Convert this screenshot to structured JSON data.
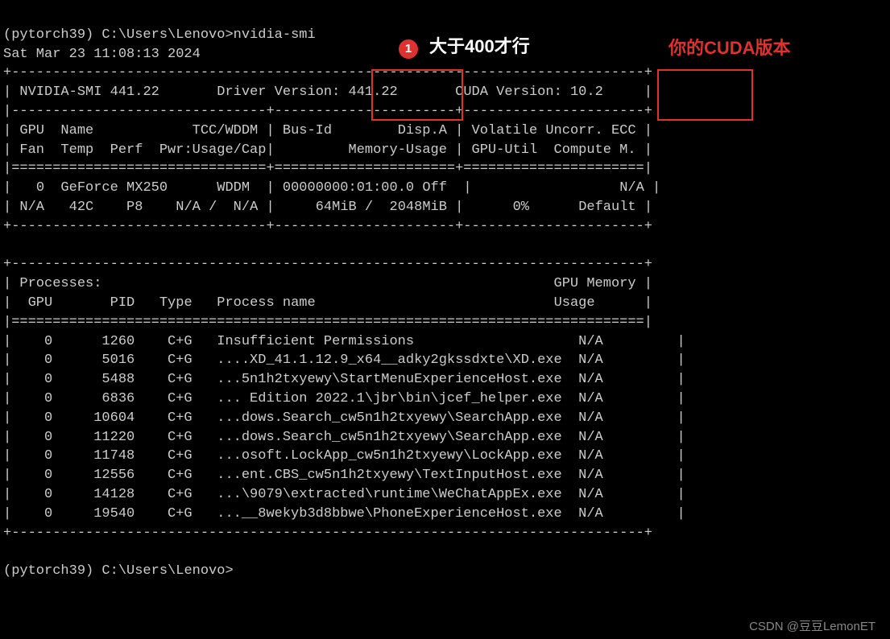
{
  "prompt": {
    "env": "(pytorch39)",
    "path": "C:\\Users\\Lenovo>",
    "command": "nvidia-smi"
  },
  "timestamp": "Sat Mar 23 11:08:13 2024",
  "header": {
    "smi_label": "NVIDIA-SMI",
    "smi_version": "441.22",
    "driver_label": "Driver Version:",
    "driver_version": "441.22",
    "cuda_label": "CUDA Version:",
    "cuda_version": "10.2"
  },
  "table_headers": {
    "col1": " GPU  Name            TCC/WDDM",
    "col1b": " Fan  Temp  Perf  Pwr:Usage/Cap",
    "col2": "Bus-Id        Disp.A",
    "col2b": "Memory-Usage",
    "col3": "Volatile Uncorr. ECC",
    "col3b": "GPU-Util  Compute M."
  },
  "gpu_row": {
    "gpu": "0",
    "name": "GeForce MX250",
    "mode": "WDDM",
    "fan": "N/A",
    "temp": "42C",
    "perf": "P8",
    "pwr": "N/A /  N/A",
    "bus_id": "00000000:01:00.0",
    "disp_a": "Off",
    "memory_usage": "64MiB /  2048MiB",
    "ecc": "N/A",
    "gpu_util": "0%",
    "compute_m": "Default"
  },
  "process_header": {
    "title": "Processes:",
    "gpu": "GPU",
    "pid": "PID",
    "type": "Type",
    "name": "Process name",
    "mem": "GPU Memory",
    "usage": "Usage"
  },
  "processes": [
    {
      "gpu": "0",
      "pid": "1260",
      "type": "C+G",
      "name": "Insufficient Permissions",
      "usage": "N/A"
    },
    {
      "gpu": "0",
      "pid": "5016",
      "type": "C+G",
      "name": "....XD_41.1.12.9_x64__adky2gkssdxte\\XD.exe",
      "usage": "N/A"
    },
    {
      "gpu": "0",
      "pid": "5488",
      "type": "C+G",
      "name": "...5n1h2txyewy\\StartMenuExperienceHost.exe",
      "usage": "N/A"
    },
    {
      "gpu": "0",
      "pid": "6836",
      "type": "C+G",
      "name": "... Edition 2022.1\\jbr\\bin\\jcef_helper.exe",
      "usage": "N/A"
    },
    {
      "gpu": "0",
      "pid": "10604",
      "type": "C+G",
      "name": "...dows.Search_cw5n1h2txyewy\\SearchApp.exe",
      "usage": "N/A"
    },
    {
      "gpu": "0",
      "pid": "11220",
      "type": "C+G",
      "name": "...dows.Search_cw5n1h2txyewy\\SearchApp.exe",
      "usage": "N/A"
    },
    {
      "gpu": "0",
      "pid": "11748",
      "type": "C+G",
      "name": "...osoft.LockApp_cw5n1h2txyewy\\LockApp.exe",
      "usage": "N/A"
    },
    {
      "gpu": "0",
      "pid": "12556",
      "type": "C+G",
      "name": "...ent.CBS_cw5n1h2txyewy\\TextInputHost.exe",
      "usage": "N/A"
    },
    {
      "gpu": "0",
      "pid": "14128",
      "type": "C+G",
      "name": "...\\9079\\extracted\\runtime\\WeChatAppEx.exe",
      "usage": "N/A"
    },
    {
      "gpu": "0",
      "pid": "19540",
      "type": "C+G",
      "name": "...__8wekyb3d8bbwe\\PhoneExperienceHost.exe",
      "usage": "N/A"
    }
  ],
  "annotations": {
    "badge1": "1",
    "note1": "大于400才行",
    "note2": "你的CUDA版本"
  },
  "watermark": "CSDN @豆豆LemonET"
}
